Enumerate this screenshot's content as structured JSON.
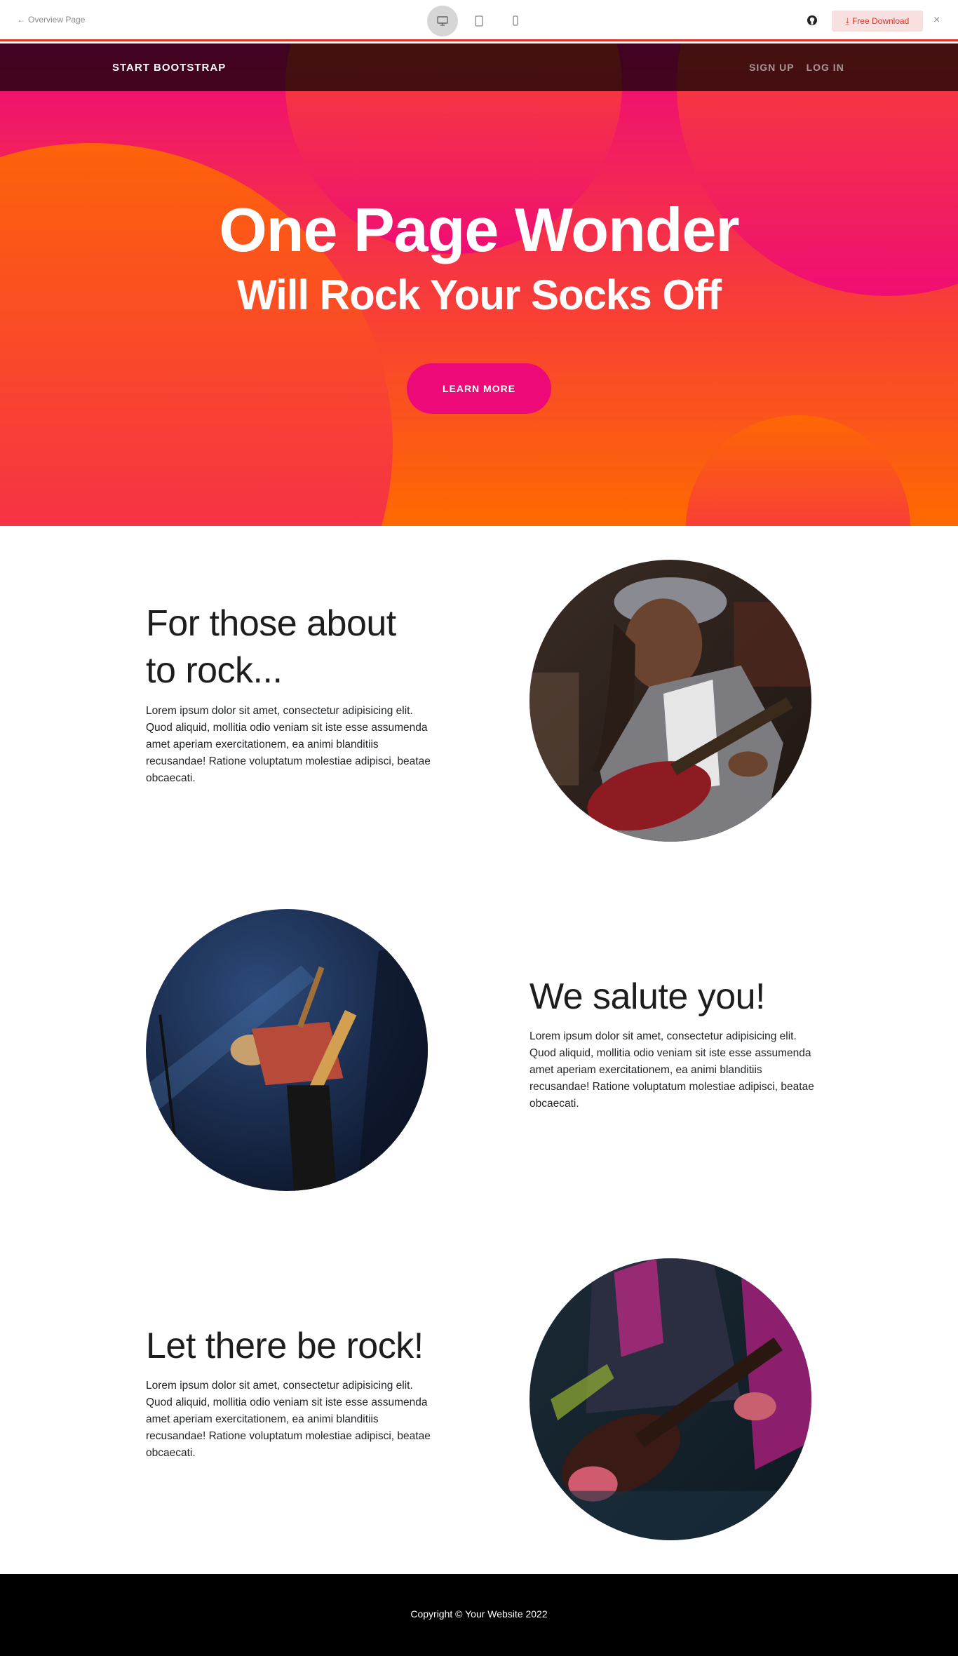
{
  "preview_bar": {
    "back_label": "Overview Page",
    "download_label": "Free Download",
    "devices": [
      "desktop-icon",
      "tablet-icon",
      "phone-icon"
    ],
    "accent_color": "#d9372a"
  },
  "navbar": {
    "brand": "START BOOTSTRAP",
    "links": [
      "SIGN UP",
      "LOG IN"
    ]
  },
  "hero": {
    "title": "One Page Wonder",
    "subtitle": "Will Rock Your Socks Off",
    "button": "LEARN MORE",
    "gradient": [
      "#ee0979",
      "#ff6a00"
    ]
  },
  "sections": [
    {
      "title": "For those about to rock...",
      "text": "Lorem ipsum dolor sit amet, consectetur adipisicing elit. Quod aliquid, mollitia odio veniam sit iste esse assumenda amet aperiam exercitationem, ea animi blanditiis recusandae! Ratione voluptatum molestiae adipisci, beatae obcaecati.",
      "image": "woman-playing-guitar-photo"
    },
    {
      "title": "We salute you!",
      "text": "Lorem ipsum dolor sit amet, consectetur adipisicing elit. Quod aliquid, mollitia odio veniam sit iste esse assumenda amet aperiam exercitationem, ea animi blanditiis recusandae! Ratione voluptatum molestiae adipisci, beatae obcaecati.",
      "image": "guitarist-on-stage-photo"
    },
    {
      "title": "Let there be rock!",
      "text": "Lorem ipsum dolor sit amet, consectetur adipisicing elit. Quod aliquid, mollitia odio veniam sit iste esse assumenda amet aperiam exercitationem, ea animi blanditiis recusandae! Ratione voluptatum molestiae adipisci, beatae obcaecati.",
      "image": "guitar-closeup-neon-photo"
    }
  ],
  "footer": {
    "copyright": "Copyright © Your Website 2022"
  }
}
